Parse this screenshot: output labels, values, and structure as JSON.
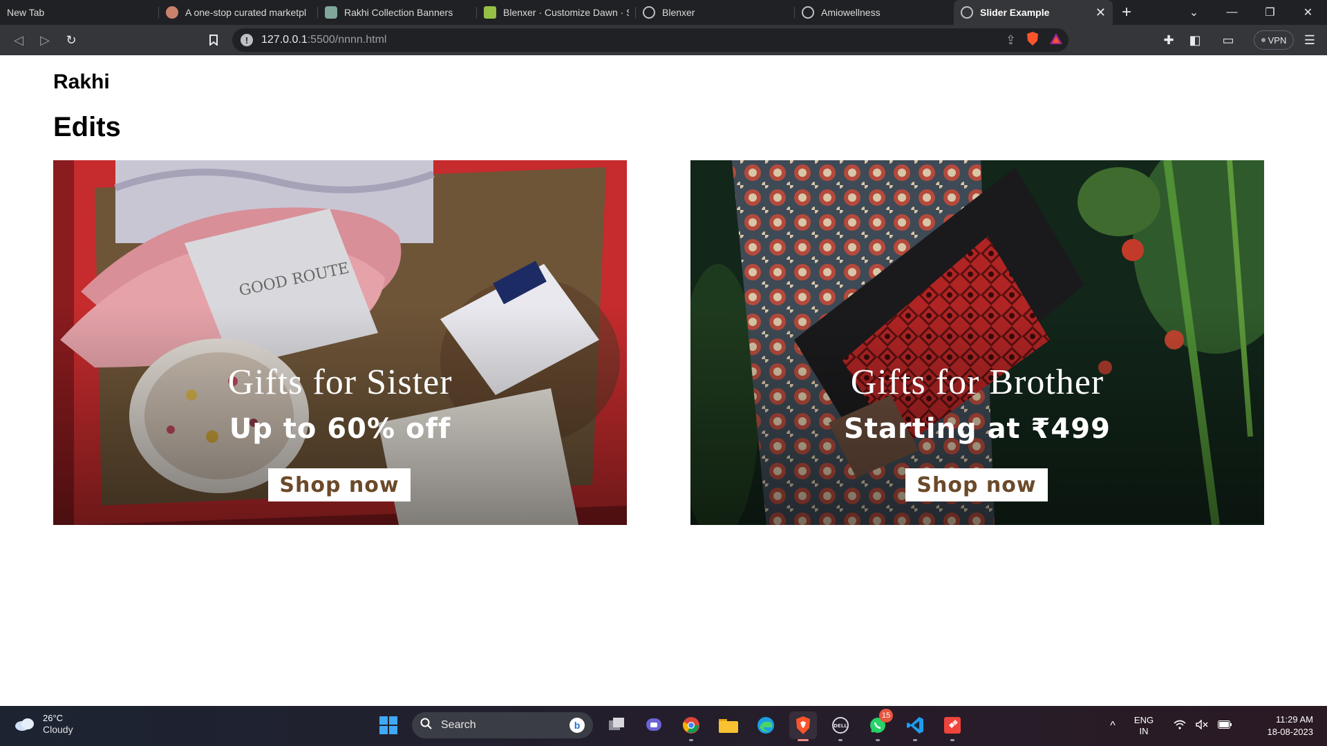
{
  "browser": {
    "tabs": [
      {
        "title": "New Tab",
        "active": false
      },
      {
        "title": "A one-stop curated marketpl",
        "active": false
      },
      {
        "title": "Rakhi Collection Banners",
        "active": false
      },
      {
        "title": "Blenxer · Customize Dawn · S",
        "active": false
      },
      {
        "title": "Blenxer",
        "active": false
      },
      {
        "title": "Amiowellness",
        "active": false
      },
      {
        "title": "Slider Example",
        "active": true
      }
    ],
    "new_tab_symbol": "+",
    "url_host": "127.0.0.1",
    "url_path": ":5500/nnnn.html",
    "vpn_label": "VPN",
    "colors": {
      "chrome_dark": "#202124",
      "toolbar": "#35363a"
    }
  },
  "page": {
    "brand": "Rakhi",
    "section_title": "Edits",
    "banners": [
      {
        "heading": "Gifts for Sister",
        "subheading": "Up to 60% off",
        "button": "Shop now",
        "image": "gift-box-pillow-jar-photo"
      },
      {
        "heading": "Gifts for Brother",
        "subheading": "Starting at ₹499",
        "button": "Shop now",
        "image": "man-holding-red-pattern-bag-photo"
      }
    ],
    "button_text_color": "#6b4a2a"
  },
  "taskbar": {
    "weather_temp": "26°C",
    "weather_condition": "Cloudy",
    "search_label": "Search",
    "whatsapp_badge": "15",
    "language_line1": "ENG",
    "language_line2": "IN",
    "time": "11:29 AM",
    "date": "18-08-2023"
  }
}
